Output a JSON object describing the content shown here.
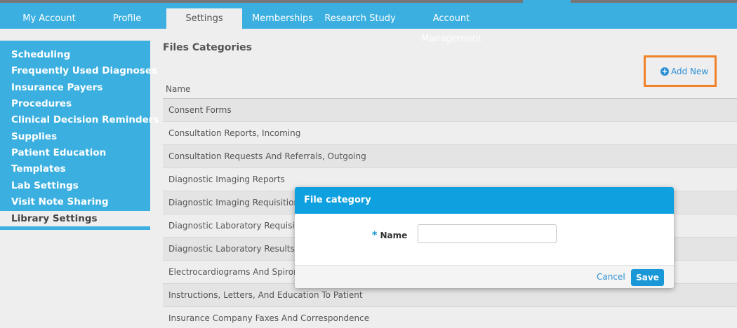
{
  "tabs": [
    {
      "label": "My Account"
    },
    {
      "label": "Profile"
    },
    {
      "label": "Settings"
    },
    {
      "label": "Memberships"
    },
    {
      "label": "Research Study"
    },
    {
      "label": "Account Management"
    }
  ],
  "sidebar": {
    "items": [
      {
        "label": "Scheduling"
      },
      {
        "label": "Frequently Used Diagnoses"
      },
      {
        "label": "Insurance Payers"
      },
      {
        "label": "Procedures"
      },
      {
        "label": "Clinical Decision Reminders"
      },
      {
        "label": "Supplies"
      },
      {
        "label": "Patient Education"
      },
      {
        "label": "Templates"
      },
      {
        "label": "Lab Settings"
      },
      {
        "label": "Visit Note Sharing"
      },
      {
        "label": "Library Settings"
      }
    ]
  },
  "main": {
    "title": "Files Categories",
    "add_new_label": "Add New",
    "column_header": "Name",
    "rows": [
      "Consent Forms",
      "Consultation Reports, Incoming",
      "Consultation Requests And Referrals, Outgoing",
      "Diagnostic Imaging Reports",
      "Diagnostic Imaging Requisitions",
      "Diagnostic Laboratory Requisitions",
      "Diagnostic Laboratory Results",
      "Electrocardiograms And Spirometry",
      "Instructions, Letters, And Education To Patient",
      "Insurance Company Faxes And Correspondence"
    ]
  },
  "modal": {
    "title": "File category",
    "required_mark": "*",
    "name_label": "Name",
    "name_value": "",
    "cancel_label": "Cancel",
    "save_label": "Save"
  },
  "colors": {
    "accent": "#3aafe0",
    "modal_header": "#0ea0df",
    "highlight": "#f0822a"
  }
}
